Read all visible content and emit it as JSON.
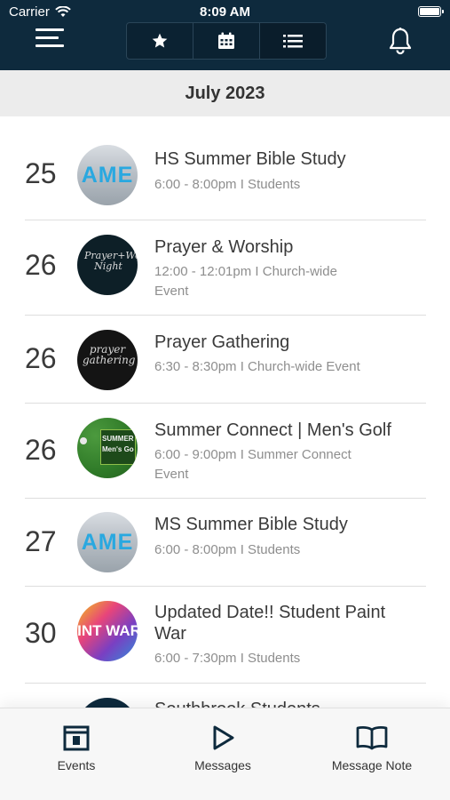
{
  "status": {
    "carrier": "Carrier",
    "time": "8:09 AM"
  },
  "header": {
    "segments": [
      {
        "icon": "star-icon",
        "selected": false
      },
      {
        "icon": "calendar-icon",
        "selected": false
      },
      {
        "icon": "list-icon",
        "selected": true
      }
    ]
  },
  "month": "July 2023",
  "events": [
    {
      "day": "25",
      "title": "HS Summer Bible Study",
      "meta_line1": "6:00  -  8:00pm  I  Students",
      "meta_line2": "",
      "thumb": "AME"
    },
    {
      "day": "26",
      "title": "Prayer & Worship",
      "meta_line1": "12:00  -  12:01pm  I  Church-wide",
      "meta_line2": "Event",
      "thumb": "Prayer+Worship Night"
    },
    {
      "day": "26",
      "title": "Prayer Gathering",
      "meta_line1": "6:30  -  8:30pm  I  Church-wide Event",
      "meta_line2": "",
      "thumb": "prayer gathering"
    },
    {
      "day": "26",
      "title": "Summer Connect | Men's Golf",
      "meta_line1": "6:00  -  9:00pm  I  Summer Connect",
      "meta_line2": "Event",
      "thumb": "SUMMER Men's Go"
    },
    {
      "day": "27",
      "title": "MS Summer Bible Study",
      "meta_line1": "6:00  -  8:00pm  I  Students",
      "meta_line2": "",
      "thumb": "AME"
    },
    {
      "day": "30",
      "title": "Updated Date!! Student Paint War",
      "meta_line1": "6:00  -  7:30pm  I  Students",
      "meta_line2": "",
      "thumb": "INT WAR"
    },
    {
      "day": "",
      "title": "Southbrook Students",
      "meta_line1": "",
      "meta_line2": "",
      "thumb": ""
    }
  ],
  "tabs": [
    {
      "label": "Events",
      "icon": "calendar-day-icon"
    },
    {
      "label": "Messages",
      "icon": "play-icon"
    },
    {
      "label": "Message Note",
      "icon": "open-book-icon"
    }
  ],
  "colors": {
    "header_bg": "#0e2a3d",
    "month_bar_bg": "#ececec",
    "tabbar_bg": "#f7f7f7"
  }
}
